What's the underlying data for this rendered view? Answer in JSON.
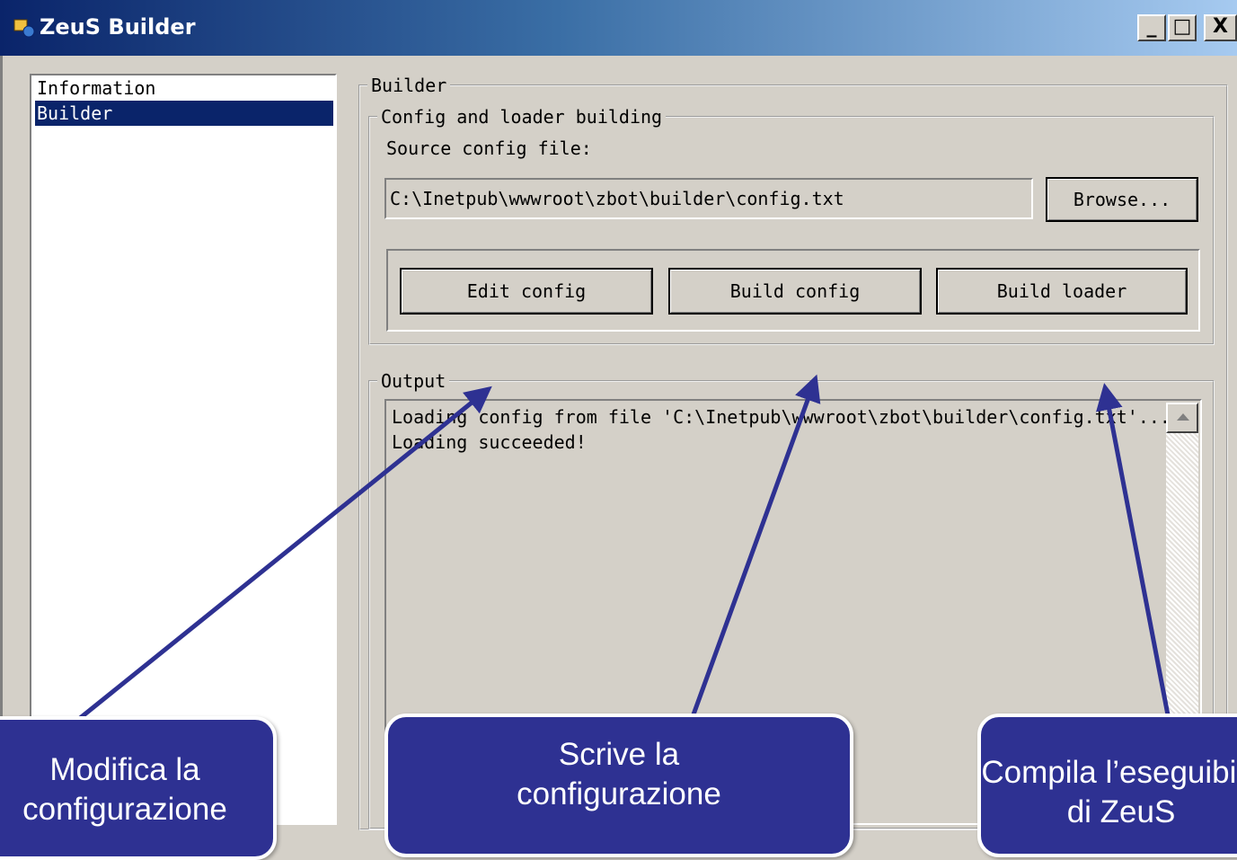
{
  "window": {
    "title": "ZeuS Builder",
    "minimize_label": "_",
    "maximize_label": "□",
    "close_label": "X"
  },
  "sidebar": {
    "items": [
      {
        "label": "Information",
        "selected": false
      },
      {
        "label": "Builder",
        "selected": true
      }
    ]
  },
  "builder": {
    "group_label": "Builder",
    "config_group_label": "Config and loader building",
    "source_label": "Source config file:",
    "source_value": "C:\\Inetpub\\wwwroot\\zbot\\builder\\config.txt",
    "browse_label": "Browse...",
    "edit_config_label": "Edit config",
    "build_config_label": "Build config",
    "build_loader_label": "Build loader"
  },
  "output": {
    "group_label": "Output",
    "lines": [
      "Loading config from file 'C:\\Inetpub\\wwwroot\\zbot\\builder\\config.txt'...",
      "Loading succeeded!"
    ]
  },
  "callouts": [
    {
      "line1": "Modifica la",
      "line2": "configurazione"
    },
    {
      "line1": "Scrive la",
      "line2": "configurazione"
    },
    {
      "line1": "Compila l’eseguibile",
      "line2": "di ZeuS"
    }
  ],
  "colors": {
    "callout_fill": "#2e3192",
    "arrow": "#2e3192",
    "selection": "#0a246a",
    "dialog_bg": "#d4d0c8"
  }
}
